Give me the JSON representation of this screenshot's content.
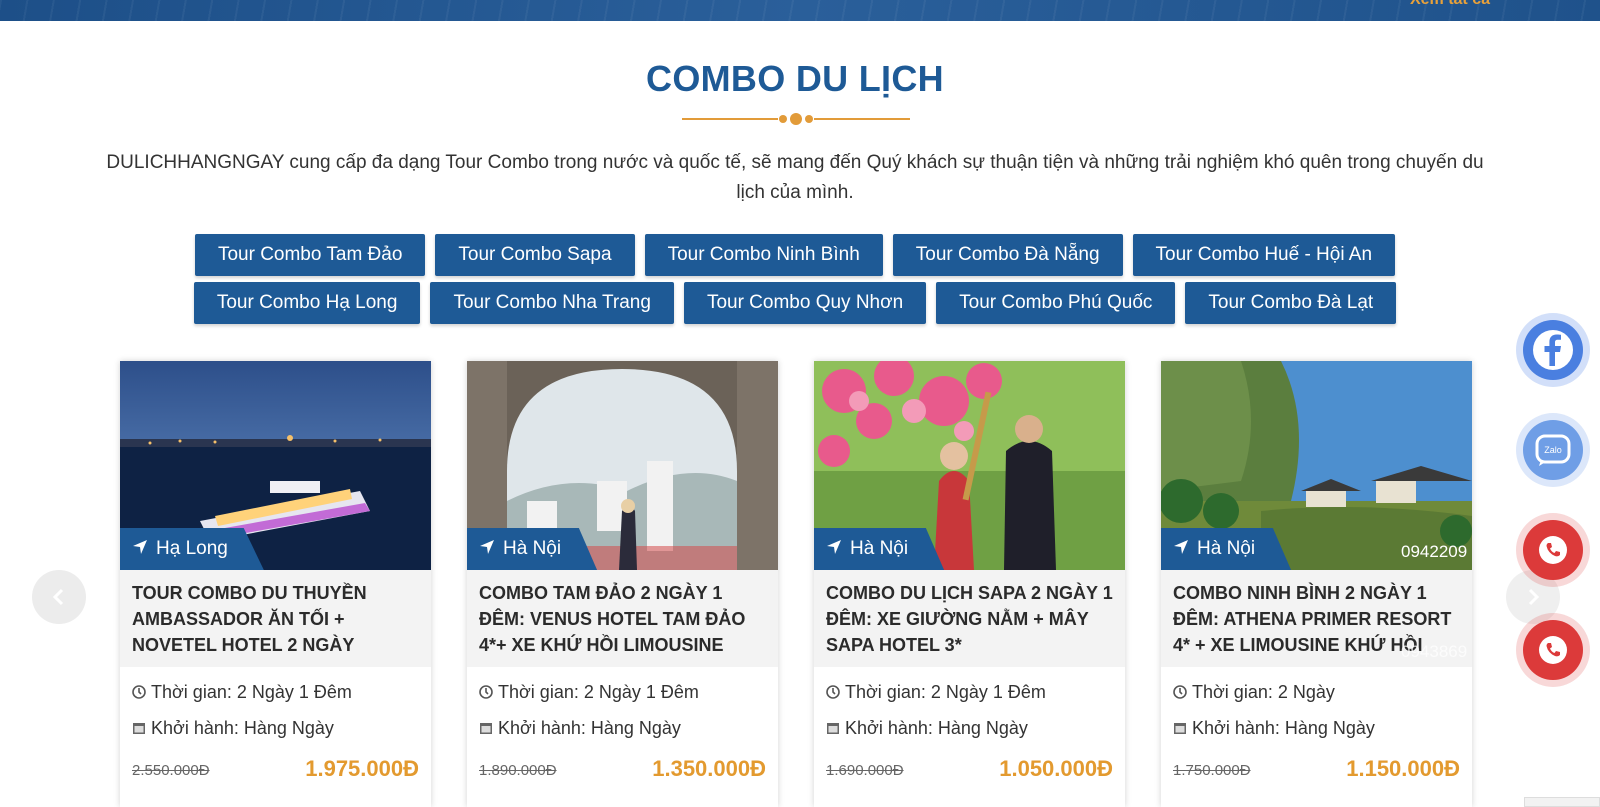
{
  "topbar": {
    "link_text": "Xem tất cả"
  },
  "section": {
    "title": "COMBO DU LỊCH",
    "intro": "DULICHHANGNGAY cung cấp đa dạng Tour Combo trong nước và quốc tế, sẽ mang đến Quý khách sự thuận tiện và những trải nghiệm khó quên trong chuyến du lịch của mình."
  },
  "tags": {
    "row1": [
      "Tour Combo Tam Đảo",
      "Tour Combo Sapa",
      "Tour Combo Ninh Bình",
      "Tour Combo Đà Nẵng",
      "Tour Combo Huế - Hội An"
    ],
    "row2": [
      "Tour Combo Hạ Long",
      "Tour Combo Nha Trang",
      "Tour Combo Quy Nhơn",
      "Tour Combo Phú Quốc",
      "Tour Combo Đà Lạt"
    ]
  },
  "cards": [
    {
      "location": "Hạ Long",
      "title": "TOUR COMBO DU THUYỀN AMBASSADOR ĂN TỐI + NOVETEL HOTEL 2 NGÀY",
      "time": "Thời gian: 2 Ngày 1 Đêm",
      "departure": "Khởi hành: Hàng Ngày",
      "old_price": "2.550.000Đ",
      "new_price": "1.975.000Đ"
    },
    {
      "location": "Hà Nội",
      "title": "COMBO TAM ĐẢO 2 NGÀY 1 ĐÊM: VENUS HOTEL TAM ĐẢO 4*+ XE KHỨ HỒI LIMOUSINE",
      "time": "Thời gian: 2 Ngày 1 Đêm",
      "departure": "Khởi hành: Hàng Ngày",
      "old_price": "1.890.000Đ",
      "new_price": "1.350.000Đ"
    },
    {
      "location": "Hà Nội",
      "title": "COMBO DU LỊCH SAPA 2 NGÀY 1 ĐÊM: XE GIƯỜNG NẰM + MÂY SAPA HOTEL 3*",
      "time": "Thời gian: 2 Ngày 1 Đêm",
      "departure": "Khởi hành: Hàng Ngày",
      "old_price": "1.690.000Đ",
      "new_price": "1.050.000Đ"
    },
    {
      "location": "Hà Nội",
      "title": "COMBO NINH BÌNH 2 NGÀY 1 ĐÊM: ATHENA PRIMER RESORT 4* + XE LIMOUSINE KHỨ HỒI",
      "time": "Thời gian: 2 Ngày",
      "departure": "Khởi hành: Hàng Ngày",
      "old_price": "1.750.000Đ",
      "new_price": "1.150.000Đ"
    }
  ],
  "floating": {
    "zalo_label": "Zalo",
    "phone1": "0942209",
    "phone2": "0943869"
  },
  "icons": {
    "prev": "chevron-left-icon",
    "next": "chevron-right-icon",
    "location": "location-arrow-icon",
    "clock": "clock-icon",
    "calendar": "calendar-icon"
  },
  "colors": {
    "brand_blue": "#1e5a96",
    "accent_orange": "#e39a2f",
    "call_red": "#dc3a3a",
    "facebook_blue": "#4a7fe0"
  }
}
